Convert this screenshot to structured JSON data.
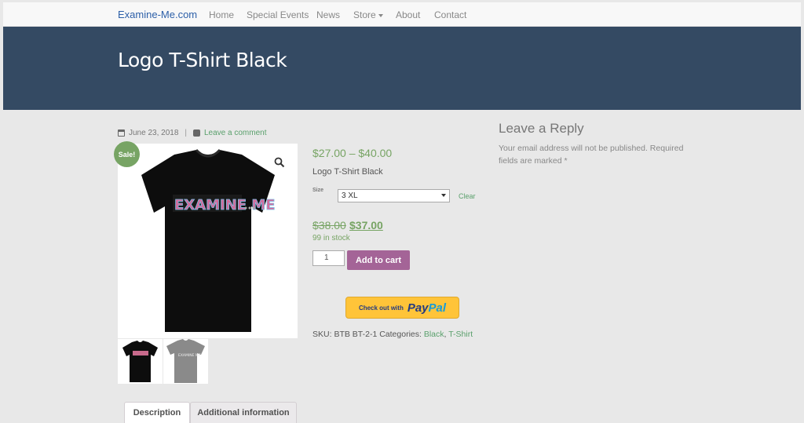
{
  "nav": {
    "brand": "Examine-Me.com",
    "items": [
      "Home",
      "Special Events",
      "News",
      "Store",
      "About",
      "Contact"
    ]
  },
  "page": {
    "title": "Logo T-Shirt Black"
  },
  "meta": {
    "date": "June 23, 2018",
    "separator": "|",
    "comment_link": "Leave a comment"
  },
  "product": {
    "sale_badge": "Sale!",
    "price_range": "$27.00 – $40.00",
    "short_description": "Logo T-Shirt Black",
    "size_label": "Size",
    "size_selected": "3 XL",
    "clear_label": "Clear",
    "old_price": "$38.00",
    "new_price": "$37.00",
    "stock": "99 in stock",
    "quantity": "1",
    "add_to_cart": "Add to cart",
    "paypal": {
      "checkout": "Check out with",
      "pay": "Pay",
      "pal": "Pal"
    },
    "sku_label": "SKU:",
    "sku": "BTB BT-2-1",
    "categories_label": "Categories:",
    "categories": [
      "Black",
      "T-Shirt"
    ],
    "category_sep": ", ",
    "shirt_print": "EXAMINE ME",
    "thumb2_print": "EXAMINE ME"
  },
  "reply": {
    "title": "Leave a Reply",
    "note": "Your email address will not be published. Required fields are marked *"
  },
  "tabs": [
    "Description",
    "Additional information"
  ],
  "colors": {
    "banner": "#344a63",
    "accent_green": "#77a464",
    "cart_purple": "#a46497",
    "paypal_yellow": "#ffc439",
    "brand_blue": "#2c5fa8"
  },
  "icons": [
    "calendar-icon",
    "comment-icon",
    "zoom-icon",
    "caret-down-icon",
    "select-arrow-icon"
  ]
}
